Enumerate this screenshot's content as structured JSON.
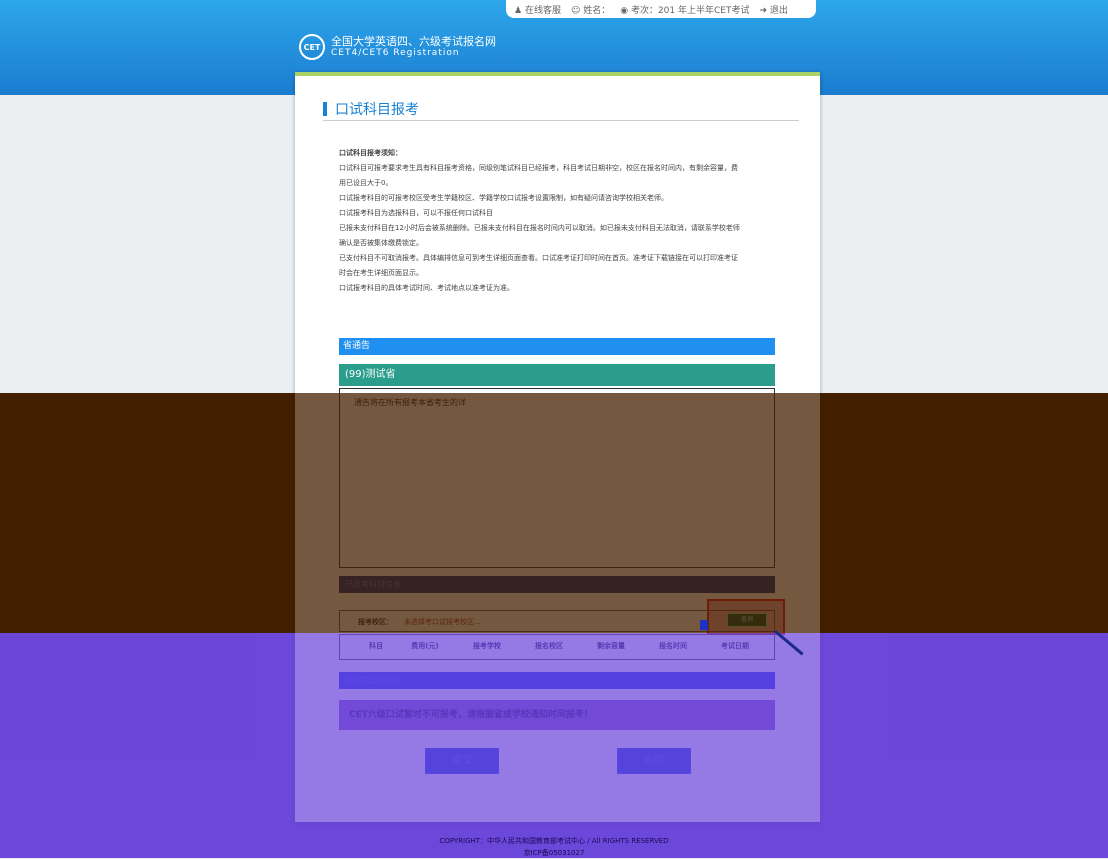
{
  "topbar": {
    "service": "在线客服",
    "name_label": "姓名：",
    "exam_label": "考次：201  年上半年CET考试",
    "logout": "退出"
  },
  "site": {
    "title": "全国大学英语四、六级考试报名网",
    "subtitle": "CET4/CET6  Registration",
    "logo_text": "CET"
  },
  "page": {
    "heading": "口试科目报考"
  },
  "notice": {
    "title": "口试科目报考须知：",
    "lines": [
      "口试科目可报考要求考生具有科目报考资格，同级别笔试科目已经报考，科目考试日期非空，校区在报名时间内，有剩余容量，费",
      "用已设且大于0。",
      "口试报考科目的可报考校区受考生学籍校区、学籍学校口试报考设置限制，如有疑问请咨询学校相关老师。",
      "口试报考科目为选报科目，可以不报任何口试科目",
      "已报未支付科目在12小时后会被系统删除。已报未支付科目在报名时间内可以取消。如已报未支付科目无法取消，请联系学校老师",
      "确认是否被集体缴费锁定。",
      "已支付科目不可取消报考。具体编排信息可到考生详细页面查看。口试准考证打印时间在首页。准考证下载链接在可以打印准考证",
      "时会在考生详细页面显示。",
      "口试报考科目的具体考试时间、考试地点以准考证为准。"
    ]
  },
  "province_announce": "省通告",
  "test_province": "(99)测试省",
  "announce_text": "通告将在所有报考本省考生的详",
  "section_registered": "已报考科目信息",
  "filter": {
    "label": "报考校区：",
    "value": "未选择考口试报考校区...",
    "button": "查询"
  },
  "table": {
    "headers": [
      "科目",
      "费用(元)",
      "报考学校",
      "报名校区",
      "剩余容量",
      "报名时间",
      "考试日期"
    ]
  },
  "section_available": "可报考口试科目",
  "warning": "CET六级口试暂时不可报考，请根据省或学校通知时间报考！",
  "buttons": {
    "submit": "提交",
    "back": "返回"
  },
  "footer": {
    "copyright": "COPYRIGHT：中华人民共和国教育部考试中心 / All RIGHTS RESERVED",
    "icp": "京ICP备05031027"
  }
}
